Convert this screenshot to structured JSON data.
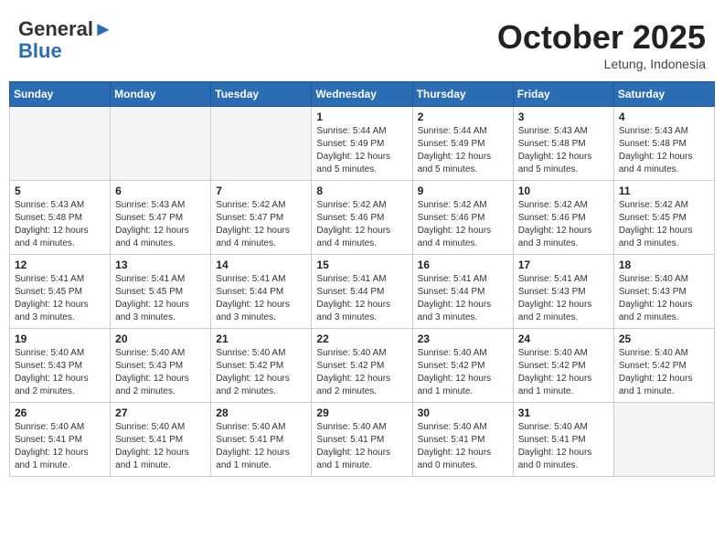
{
  "header": {
    "logo_general": "General",
    "logo_blue": "Blue",
    "month": "October 2025",
    "location": "Letung, Indonesia"
  },
  "days_of_week": [
    "Sunday",
    "Monday",
    "Tuesday",
    "Wednesday",
    "Thursday",
    "Friday",
    "Saturday"
  ],
  "weeks": [
    [
      {
        "day": "",
        "empty": true
      },
      {
        "day": "",
        "empty": true
      },
      {
        "day": "",
        "empty": true
      },
      {
        "day": "1",
        "sunrise": "Sunrise: 5:44 AM",
        "sunset": "Sunset: 5:49 PM",
        "daylight": "Daylight: 12 hours and 5 minutes."
      },
      {
        "day": "2",
        "sunrise": "Sunrise: 5:44 AM",
        "sunset": "Sunset: 5:49 PM",
        "daylight": "Daylight: 12 hours and 5 minutes."
      },
      {
        "day": "3",
        "sunrise": "Sunrise: 5:43 AM",
        "sunset": "Sunset: 5:48 PM",
        "daylight": "Daylight: 12 hours and 5 minutes."
      },
      {
        "day": "4",
        "sunrise": "Sunrise: 5:43 AM",
        "sunset": "Sunset: 5:48 PM",
        "daylight": "Daylight: 12 hours and 4 minutes."
      }
    ],
    [
      {
        "day": "5",
        "sunrise": "Sunrise: 5:43 AM",
        "sunset": "Sunset: 5:48 PM",
        "daylight": "Daylight: 12 hours and 4 minutes."
      },
      {
        "day": "6",
        "sunrise": "Sunrise: 5:43 AM",
        "sunset": "Sunset: 5:47 PM",
        "daylight": "Daylight: 12 hours and 4 minutes."
      },
      {
        "day": "7",
        "sunrise": "Sunrise: 5:42 AM",
        "sunset": "Sunset: 5:47 PM",
        "daylight": "Daylight: 12 hours and 4 minutes."
      },
      {
        "day": "8",
        "sunrise": "Sunrise: 5:42 AM",
        "sunset": "Sunset: 5:46 PM",
        "daylight": "Daylight: 12 hours and 4 minutes."
      },
      {
        "day": "9",
        "sunrise": "Sunrise: 5:42 AM",
        "sunset": "Sunset: 5:46 PM",
        "daylight": "Daylight: 12 hours and 4 minutes."
      },
      {
        "day": "10",
        "sunrise": "Sunrise: 5:42 AM",
        "sunset": "Sunset: 5:46 PM",
        "daylight": "Daylight: 12 hours and 3 minutes."
      },
      {
        "day": "11",
        "sunrise": "Sunrise: 5:42 AM",
        "sunset": "Sunset: 5:45 PM",
        "daylight": "Daylight: 12 hours and 3 minutes."
      }
    ],
    [
      {
        "day": "12",
        "sunrise": "Sunrise: 5:41 AM",
        "sunset": "Sunset: 5:45 PM",
        "daylight": "Daylight: 12 hours and 3 minutes."
      },
      {
        "day": "13",
        "sunrise": "Sunrise: 5:41 AM",
        "sunset": "Sunset: 5:45 PM",
        "daylight": "Daylight: 12 hours and 3 minutes."
      },
      {
        "day": "14",
        "sunrise": "Sunrise: 5:41 AM",
        "sunset": "Sunset: 5:44 PM",
        "daylight": "Daylight: 12 hours and 3 minutes."
      },
      {
        "day": "15",
        "sunrise": "Sunrise: 5:41 AM",
        "sunset": "Sunset: 5:44 PM",
        "daylight": "Daylight: 12 hours and 3 minutes."
      },
      {
        "day": "16",
        "sunrise": "Sunrise: 5:41 AM",
        "sunset": "Sunset: 5:44 PM",
        "daylight": "Daylight: 12 hours and 3 minutes."
      },
      {
        "day": "17",
        "sunrise": "Sunrise: 5:41 AM",
        "sunset": "Sunset: 5:43 PM",
        "daylight": "Daylight: 12 hours and 2 minutes."
      },
      {
        "day": "18",
        "sunrise": "Sunrise: 5:40 AM",
        "sunset": "Sunset: 5:43 PM",
        "daylight": "Daylight: 12 hours and 2 minutes."
      }
    ],
    [
      {
        "day": "19",
        "sunrise": "Sunrise: 5:40 AM",
        "sunset": "Sunset: 5:43 PM",
        "daylight": "Daylight: 12 hours and 2 minutes."
      },
      {
        "day": "20",
        "sunrise": "Sunrise: 5:40 AM",
        "sunset": "Sunset: 5:43 PM",
        "daylight": "Daylight: 12 hours and 2 minutes."
      },
      {
        "day": "21",
        "sunrise": "Sunrise: 5:40 AM",
        "sunset": "Sunset: 5:42 PM",
        "daylight": "Daylight: 12 hours and 2 minutes."
      },
      {
        "day": "22",
        "sunrise": "Sunrise: 5:40 AM",
        "sunset": "Sunset: 5:42 PM",
        "daylight": "Daylight: 12 hours and 2 minutes."
      },
      {
        "day": "23",
        "sunrise": "Sunrise: 5:40 AM",
        "sunset": "Sunset: 5:42 PM",
        "daylight": "Daylight: 12 hours and 1 minute."
      },
      {
        "day": "24",
        "sunrise": "Sunrise: 5:40 AM",
        "sunset": "Sunset: 5:42 PM",
        "daylight": "Daylight: 12 hours and 1 minute."
      },
      {
        "day": "25",
        "sunrise": "Sunrise: 5:40 AM",
        "sunset": "Sunset: 5:42 PM",
        "daylight": "Daylight: 12 hours and 1 minute."
      }
    ],
    [
      {
        "day": "26",
        "sunrise": "Sunrise: 5:40 AM",
        "sunset": "Sunset: 5:41 PM",
        "daylight": "Daylight: 12 hours and 1 minute."
      },
      {
        "day": "27",
        "sunrise": "Sunrise: 5:40 AM",
        "sunset": "Sunset: 5:41 PM",
        "daylight": "Daylight: 12 hours and 1 minute."
      },
      {
        "day": "28",
        "sunrise": "Sunrise: 5:40 AM",
        "sunset": "Sunset: 5:41 PM",
        "daylight": "Daylight: 12 hours and 1 minute."
      },
      {
        "day": "29",
        "sunrise": "Sunrise: 5:40 AM",
        "sunset": "Sunset: 5:41 PM",
        "daylight": "Daylight: 12 hours and 1 minute."
      },
      {
        "day": "30",
        "sunrise": "Sunrise: 5:40 AM",
        "sunset": "Sunset: 5:41 PM",
        "daylight": "Daylight: 12 hours and 0 minutes."
      },
      {
        "day": "31",
        "sunrise": "Sunrise: 5:40 AM",
        "sunset": "Sunset: 5:41 PM",
        "daylight": "Daylight: 12 hours and 0 minutes."
      },
      {
        "day": "",
        "empty": true
      }
    ]
  ]
}
